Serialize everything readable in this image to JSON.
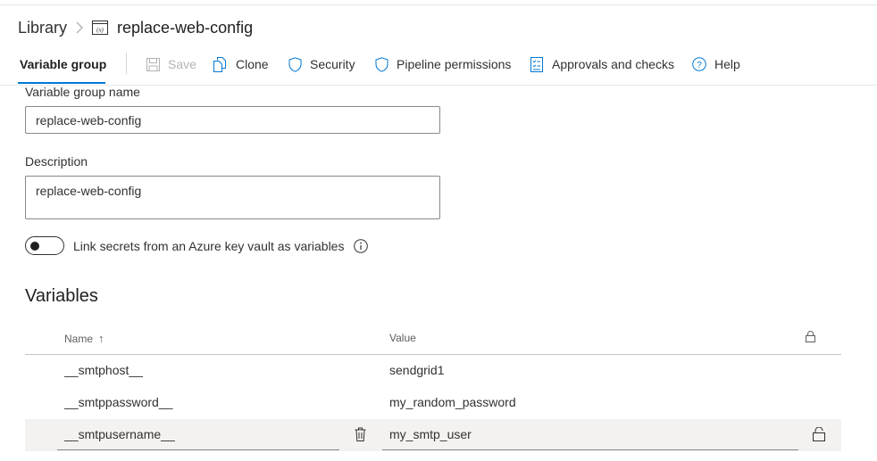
{
  "breadcrumb": {
    "library": "Library",
    "group_name": "replace-web-config"
  },
  "toolbar": {
    "active_tab": "Variable group",
    "save": "Save",
    "clone": "Clone",
    "security": "Security",
    "pipeline_permissions": "Pipeline permissions",
    "approvals": "Approvals and checks",
    "help": "Help"
  },
  "form": {
    "name_label": "Variable group name",
    "name_value": "replace-web-config",
    "description_label": "Description",
    "description_value": "replace-web-config",
    "keyvault_label": "Link secrets from an Azure key vault as variables",
    "keyvault_enabled": false
  },
  "variables": {
    "title": "Variables",
    "columns": {
      "name": "Name",
      "value": "Value"
    },
    "sort_indicator": "↑",
    "rows": [
      {
        "name": "__smtphost__",
        "value": "sendgrid1",
        "secret": false
      },
      {
        "name": "__smtppassword__",
        "value": "my_random_password",
        "secret": false
      },
      {
        "name": "__smtpusername__",
        "value": "my_smtp_user",
        "secret": false
      }
    ]
  },
  "colors": {
    "accent": "#0078d4",
    "text": "#323130",
    "muted": "#605e5c",
    "hover_row": "#f3f2f1"
  }
}
